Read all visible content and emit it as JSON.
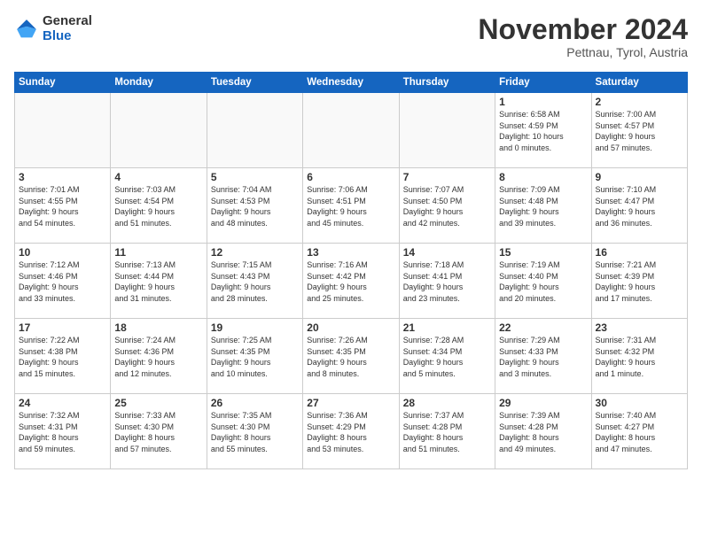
{
  "header": {
    "logo_general": "General",
    "logo_blue": "Blue",
    "month": "November 2024",
    "location": "Pettnau, Tyrol, Austria"
  },
  "days_of_week": [
    "Sunday",
    "Monday",
    "Tuesday",
    "Wednesday",
    "Thursday",
    "Friday",
    "Saturday"
  ],
  "weeks": [
    [
      {
        "day": "",
        "info": ""
      },
      {
        "day": "",
        "info": ""
      },
      {
        "day": "",
        "info": ""
      },
      {
        "day": "",
        "info": ""
      },
      {
        "day": "",
        "info": ""
      },
      {
        "day": "1",
        "info": "Sunrise: 6:58 AM\nSunset: 4:59 PM\nDaylight: 10 hours\nand 0 minutes."
      },
      {
        "day": "2",
        "info": "Sunrise: 7:00 AM\nSunset: 4:57 PM\nDaylight: 9 hours\nand 57 minutes."
      }
    ],
    [
      {
        "day": "3",
        "info": "Sunrise: 7:01 AM\nSunset: 4:55 PM\nDaylight: 9 hours\nand 54 minutes."
      },
      {
        "day": "4",
        "info": "Sunrise: 7:03 AM\nSunset: 4:54 PM\nDaylight: 9 hours\nand 51 minutes."
      },
      {
        "day": "5",
        "info": "Sunrise: 7:04 AM\nSunset: 4:53 PM\nDaylight: 9 hours\nand 48 minutes."
      },
      {
        "day": "6",
        "info": "Sunrise: 7:06 AM\nSunset: 4:51 PM\nDaylight: 9 hours\nand 45 minutes."
      },
      {
        "day": "7",
        "info": "Sunrise: 7:07 AM\nSunset: 4:50 PM\nDaylight: 9 hours\nand 42 minutes."
      },
      {
        "day": "8",
        "info": "Sunrise: 7:09 AM\nSunset: 4:48 PM\nDaylight: 9 hours\nand 39 minutes."
      },
      {
        "day": "9",
        "info": "Sunrise: 7:10 AM\nSunset: 4:47 PM\nDaylight: 9 hours\nand 36 minutes."
      }
    ],
    [
      {
        "day": "10",
        "info": "Sunrise: 7:12 AM\nSunset: 4:46 PM\nDaylight: 9 hours\nand 33 minutes."
      },
      {
        "day": "11",
        "info": "Sunrise: 7:13 AM\nSunset: 4:44 PM\nDaylight: 9 hours\nand 31 minutes."
      },
      {
        "day": "12",
        "info": "Sunrise: 7:15 AM\nSunset: 4:43 PM\nDaylight: 9 hours\nand 28 minutes."
      },
      {
        "day": "13",
        "info": "Sunrise: 7:16 AM\nSunset: 4:42 PM\nDaylight: 9 hours\nand 25 minutes."
      },
      {
        "day": "14",
        "info": "Sunrise: 7:18 AM\nSunset: 4:41 PM\nDaylight: 9 hours\nand 23 minutes."
      },
      {
        "day": "15",
        "info": "Sunrise: 7:19 AM\nSunset: 4:40 PM\nDaylight: 9 hours\nand 20 minutes."
      },
      {
        "day": "16",
        "info": "Sunrise: 7:21 AM\nSunset: 4:39 PM\nDaylight: 9 hours\nand 17 minutes."
      }
    ],
    [
      {
        "day": "17",
        "info": "Sunrise: 7:22 AM\nSunset: 4:38 PM\nDaylight: 9 hours\nand 15 minutes."
      },
      {
        "day": "18",
        "info": "Sunrise: 7:24 AM\nSunset: 4:36 PM\nDaylight: 9 hours\nand 12 minutes."
      },
      {
        "day": "19",
        "info": "Sunrise: 7:25 AM\nSunset: 4:35 PM\nDaylight: 9 hours\nand 10 minutes."
      },
      {
        "day": "20",
        "info": "Sunrise: 7:26 AM\nSunset: 4:35 PM\nDaylight: 9 hours\nand 8 minutes."
      },
      {
        "day": "21",
        "info": "Sunrise: 7:28 AM\nSunset: 4:34 PM\nDaylight: 9 hours\nand 5 minutes."
      },
      {
        "day": "22",
        "info": "Sunrise: 7:29 AM\nSunset: 4:33 PM\nDaylight: 9 hours\nand 3 minutes."
      },
      {
        "day": "23",
        "info": "Sunrise: 7:31 AM\nSunset: 4:32 PM\nDaylight: 9 hours\nand 1 minute."
      }
    ],
    [
      {
        "day": "24",
        "info": "Sunrise: 7:32 AM\nSunset: 4:31 PM\nDaylight: 8 hours\nand 59 minutes."
      },
      {
        "day": "25",
        "info": "Sunrise: 7:33 AM\nSunset: 4:30 PM\nDaylight: 8 hours\nand 57 minutes."
      },
      {
        "day": "26",
        "info": "Sunrise: 7:35 AM\nSunset: 4:30 PM\nDaylight: 8 hours\nand 55 minutes."
      },
      {
        "day": "27",
        "info": "Sunrise: 7:36 AM\nSunset: 4:29 PM\nDaylight: 8 hours\nand 53 minutes."
      },
      {
        "day": "28",
        "info": "Sunrise: 7:37 AM\nSunset: 4:28 PM\nDaylight: 8 hours\nand 51 minutes."
      },
      {
        "day": "29",
        "info": "Sunrise: 7:39 AM\nSunset: 4:28 PM\nDaylight: 8 hours\nand 49 minutes."
      },
      {
        "day": "30",
        "info": "Sunrise: 7:40 AM\nSunset: 4:27 PM\nDaylight: 8 hours\nand 47 minutes."
      }
    ]
  ]
}
